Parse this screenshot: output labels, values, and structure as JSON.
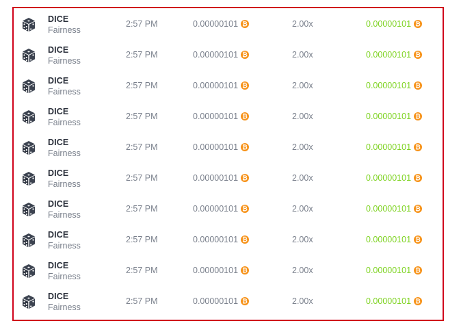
{
  "bets": {
    "coin_symbol": "₿",
    "coin_color": "#f7931a",
    "payout_color": "#7ed321",
    "rows": [
      {
        "game": "DICE",
        "sub": "Fairness",
        "time": "2:57 PM",
        "amount": "0.00000101",
        "multiplier": "2.00x",
        "payout": "0.00000101"
      },
      {
        "game": "DICE",
        "sub": "Fairness",
        "time": "2:57 PM",
        "amount": "0.00000101",
        "multiplier": "2.00x",
        "payout": "0.00000101"
      },
      {
        "game": "DICE",
        "sub": "Fairness",
        "time": "2:57 PM",
        "amount": "0.00000101",
        "multiplier": "2.00x",
        "payout": "0.00000101"
      },
      {
        "game": "DICE",
        "sub": "Fairness",
        "time": "2:57 PM",
        "amount": "0.00000101",
        "multiplier": "2.00x",
        "payout": "0.00000101"
      },
      {
        "game": "DICE",
        "sub": "Fairness",
        "time": "2:57 PM",
        "amount": "0.00000101",
        "multiplier": "2.00x",
        "payout": "0.00000101"
      },
      {
        "game": "DICE",
        "sub": "Fairness",
        "time": "2:57 PM",
        "amount": "0.00000101",
        "multiplier": "2.00x",
        "payout": "0.00000101"
      },
      {
        "game": "DICE",
        "sub": "Fairness",
        "time": "2:57 PM",
        "amount": "0.00000101",
        "multiplier": "2.00x",
        "payout": "0.00000101"
      },
      {
        "game": "DICE",
        "sub": "Fairness",
        "time": "2:57 PM",
        "amount": "0.00000101",
        "multiplier": "2.00x",
        "payout": "0.00000101"
      },
      {
        "game": "DICE",
        "sub": "Fairness",
        "time": "2:57 PM",
        "amount": "0.00000101",
        "multiplier": "2.00x",
        "payout": "0.00000101"
      },
      {
        "game": "DICE",
        "sub": "Fairness",
        "time": "2:57 PM",
        "amount": "0.00000101",
        "multiplier": "2.00x",
        "payout": "0.00000101"
      }
    ]
  }
}
